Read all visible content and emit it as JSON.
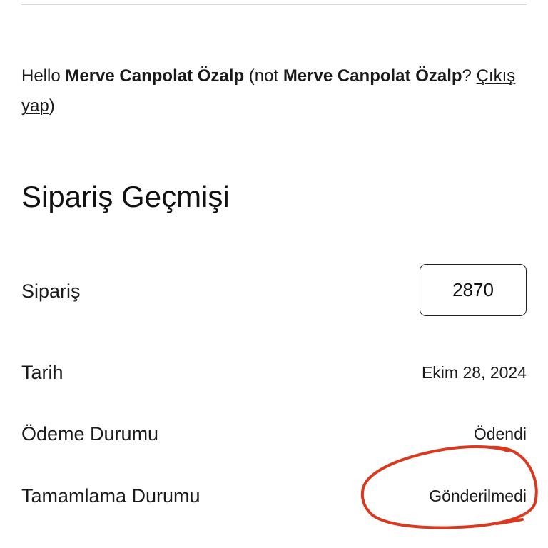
{
  "account": {
    "greeting_prefix": "Hello",
    "user_name": "Merve Canpolat Özalp",
    "not_prefix": "(not",
    "not_user_name": "Merve Canpolat Özalp",
    "question_mark": "?",
    "logout_link": "Çıkış yap",
    "close_paren": ")"
  },
  "page": {
    "title": "Sipariş Geçmişi"
  },
  "order": {
    "order_label": "Sipariş",
    "order_number": "2870",
    "date_label": "Tarih",
    "date_value": "Ekim 28, 2024",
    "payment_status_label": "Ödeme Durumu",
    "payment_status_value": "Ödendi",
    "fulfillment_status_label": "Tamamlama Durumu",
    "fulfillment_status_value": "Gönderilmedi"
  },
  "annotation": {
    "circle_color": "#d9391f",
    "circle_target": "fulfillment_status_value"
  }
}
